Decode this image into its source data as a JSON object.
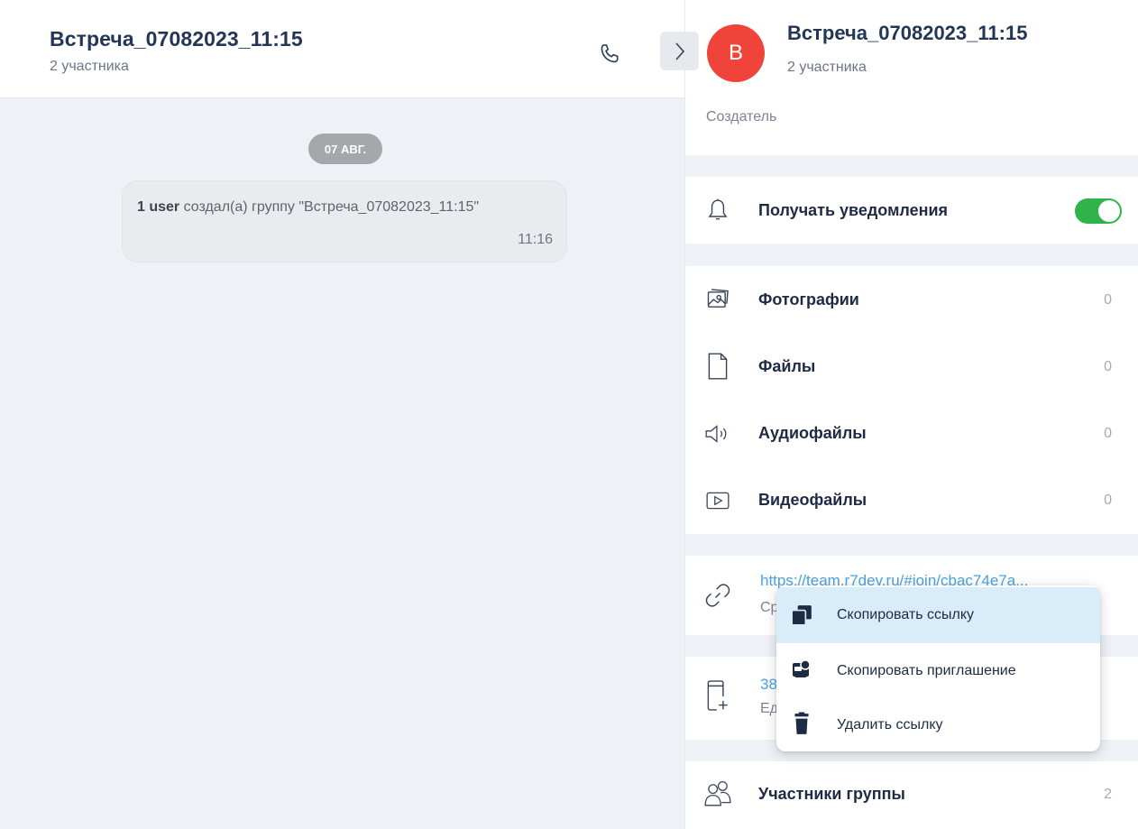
{
  "chat": {
    "title": "Встреча_07082023_11:15",
    "subtitle": "2 участника",
    "date_pill": "07 АВГ.",
    "system_message": {
      "user": "1 user",
      "text": " создал(а) группу \"Встреча_07082023_11:15\"",
      "time": "11:16"
    }
  },
  "panel": {
    "avatar_letter": "В",
    "avatar_color": "#f0443a",
    "title": "Встреча_07082023_11:15",
    "subtitle": "2 участника",
    "creator_label": "Создатель",
    "notifications": {
      "label": "Получать уведомления",
      "enabled": true,
      "toggle_color": "#2fb34a"
    },
    "media": [
      {
        "label": "Фотографии",
        "count": "0",
        "icon": "photo-icon"
      },
      {
        "label": "Файлы",
        "count": "0",
        "icon": "file-icon"
      },
      {
        "label": "Аудиофайлы",
        "count": "0",
        "icon": "audio-icon"
      },
      {
        "label": "Видеофайлы",
        "count": "0",
        "icon": "video-icon"
      }
    ],
    "invite_link": {
      "url": "https://team.r7dev.ru/#join/cbac74e7a...",
      "sub": "Ср"
    },
    "phone": {
      "number": "38",
      "sub": "Ед"
    },
    "members": {
      "label": "Участники группы",
      "count": "2"
    },
    "link_color": "#4aa3df"
  },
  "context_menu": {
    "items": [
      {
        "label": "Скопировать ссылку",
        "icon": "copy-icon",
        "active": true
      },
      {
        "label": "Скопировать приглашение",
        "icon": "invite-icon",
        "active": false
      },
      {
        "label": "Удалить ссылку",
        "icon": "trash-icon",
        "active": false
      }
    ],
    "active_color": "#d9ecf9"
  }
}
